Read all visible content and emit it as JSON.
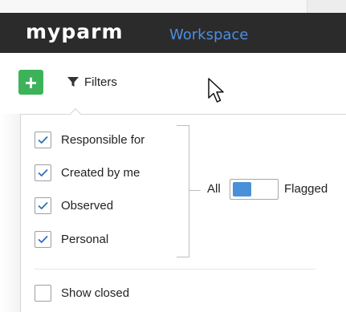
{
  "header": {
    "logo_text": "myparm",
    "workspace_label": "Workspace",
    "background": "#2b2b2b",
    "workspace_color": "#4b8fe3"
  },
  "toolbar": {
    "add_button_icon": "plus-icon",
    "add_button_color": "#3cb35a",
    "filters_icon": "funnel-icon",
    "filters_label": "Filters"
  },
  "filters": {
    "options": [
      {
        "label": "Responsible for",
        "checked": true
      },
      {
        "label": "Created by me",
        "checked": true
      },
      {
        "label": "Observed",
        "checked": true
      },
      {
        "label": "Personal",
        "checked": true
      }
    ],
    "scope_toggle": {
      "left_label": "All",
      "right_label": "Flagged",
      "accent": "#4a90d9"
    },
    "show_closed": {
      "label": "Show closed",
      "checked": false
    }
  },
  "cursor_icon": "mouse-pointer-icon"
}
